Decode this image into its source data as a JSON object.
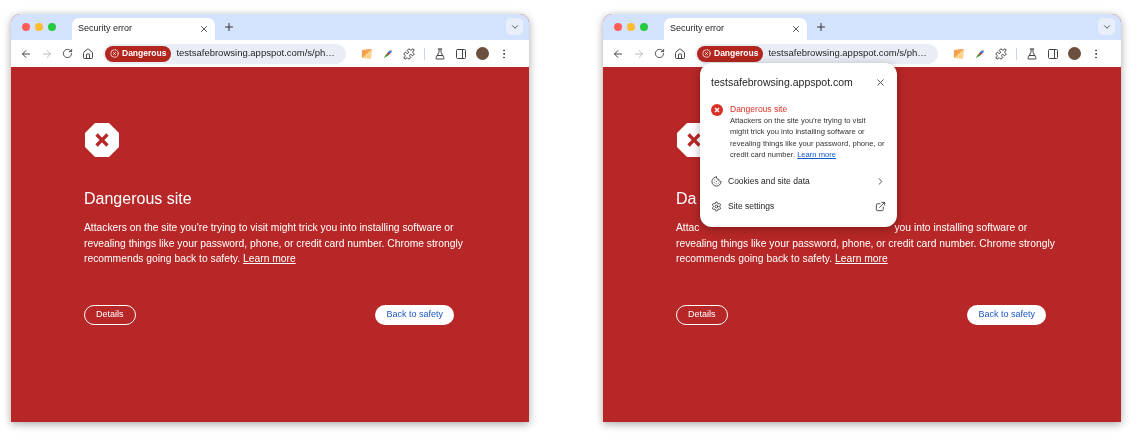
{
  "windows": [
    {
      "tab": {
        "title": "Security error"
      },
      "omnibox": {
        "badge": "Dangerous",
        "url": "testsafebrowsing.appspot.com/s/ph…"
      },
      "page": {
        "heading": "Dangerous site",
        "lines": [
          {
            "parts": [
              "Attackers on the site you're trying to visit might trick you into installing software or"
            ]
          },
          {
            "parts": [
              "revealing things like your password, phone, or credit card number. Chrome strongly"
            ]
          },
          {
            "parts": [
              "recommends going back to safety."
            ],
            "link": "Learn more"
          }
        ],
        "buttons": [
          {
            "label": "Details",
            "kind": "outline"
          },
          {
            "label": "Back to safety",
            "kind": "filled"
          }
        ]
      }
    },
    {
      "tab": {
        "title": "Security error"
      },
      "omnibox": {
        "badge": "Dangerous",
        "url": "testsafebrowsing.appspot.com/s/ph…"
      },
      "page": {
        "heading": "Da",
        "lines": [
          {
            "parts": [
              "Attac",
              "you into installing software or"
            ]
          },
          {
            "parts": [
              "revealing things like your password, phone, or credit card number. Chrome strongly"
            ]
          },
          {
            "parts": [
              "recommends going back to safety."
            ],
            "link": "Learn more"
          }
        ],
        "buttons": [
          {
            "label": "Details",
            "kind": "outline"
          },
          {
            "label": "Back to safety",
            "kind": "filled"
          }
        ]
      },
      "popup": {
        "title": "testsafebrowsing.appspot.com",
        "status": {
          "heading": "Dangerous site",
          "text": "Attackers on the site you're trying to visit might trick you into installing software or revealing things like your password, phone, or credit card number.",
          "link": "Learn more"
        },
        "rows": [
          {
            "label": "Cookies and site data",
            "kind": "submenu"
          },
          {
            "label": "Site settings",
            "kind": "external"
          }
        ]
      }
    }
  ]
}
